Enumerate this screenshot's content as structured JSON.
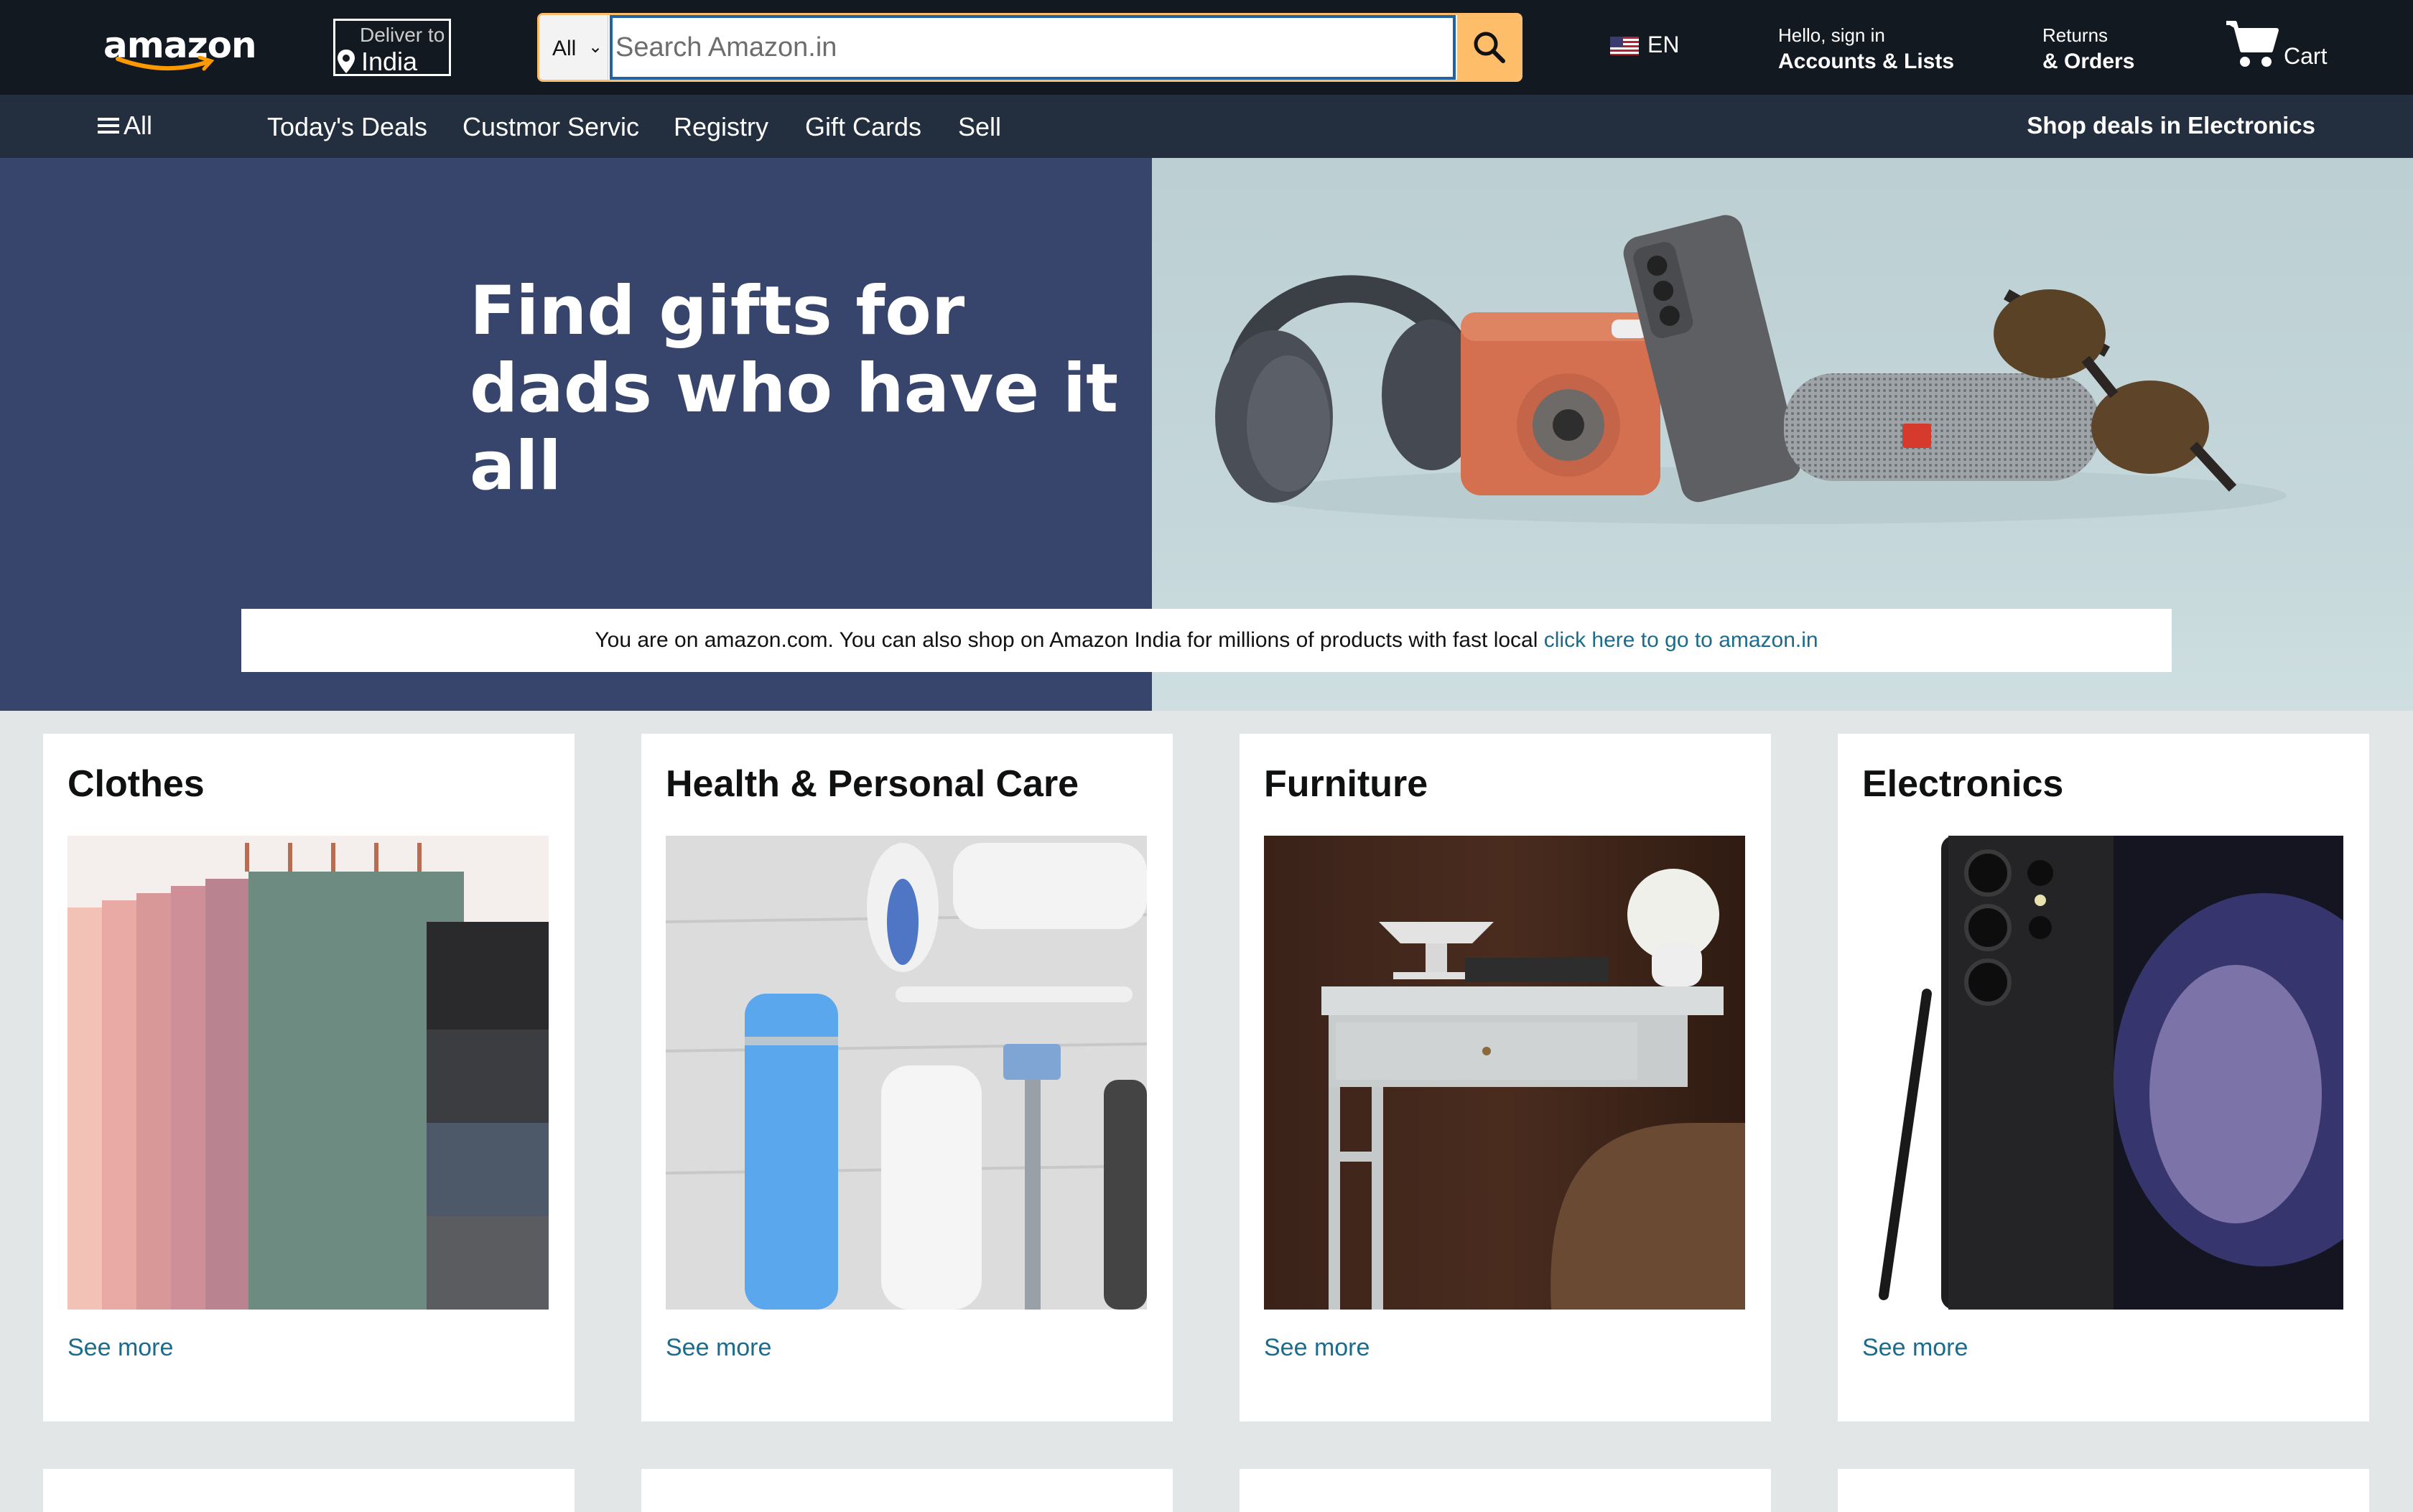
{
  "header": {
    "logo_text": "amazon",
    "deliver_to_label": "Deliver to",
    "deliver_to_location": "India",
    "search_category": "All",
    "search_placeholder": "Search Amazon.in",
    "search_value": "",
    "language": "EN",
    "account_greeting": "Hello, sign in",
    "account_label": "Accounts & Lists",
    "returns_label": "Returns",
    "orders_label": "& Orders",
    "cart_label": "Cart"
  },
  "subnav": {
    "all_label": "All",
    "links": [
      "Today's Deals",
      "Custmor Servic",
      "Registry",
      "Gift Cards",
      "Sell"
    ],
    "promo": "Shop deals in Electronics"
  },
  "hero": {
    "title_line1": "Find gifts for",
    "title_line2": "dads who have it all",
    "notice_text": "You are on amazon.com. You can also shop on Amazon India for millions of products with fast local ",
    "notice_link": "click here to go to amazon.in"
  },
  "categories": [
    {
      "title": "Clothes",
      "link": "See more"
    },
    {
      "title": "Health & Personal Care",
      "link": "See more"
    },
    {
      "title": "Furniture",
      "link": "See more"
    },
    {
      "title": "Electronics",
      "link": "See more"
    }
  ],
  "colors": {
    "topbar": "#131921",
    "subnav": "#232f3e",
    "search_button": "#febd69",
    "hero_left": "#37446b",
    "link": "#1b6b8c",
    "page_bg": "#e3e6e6"
  }
}
